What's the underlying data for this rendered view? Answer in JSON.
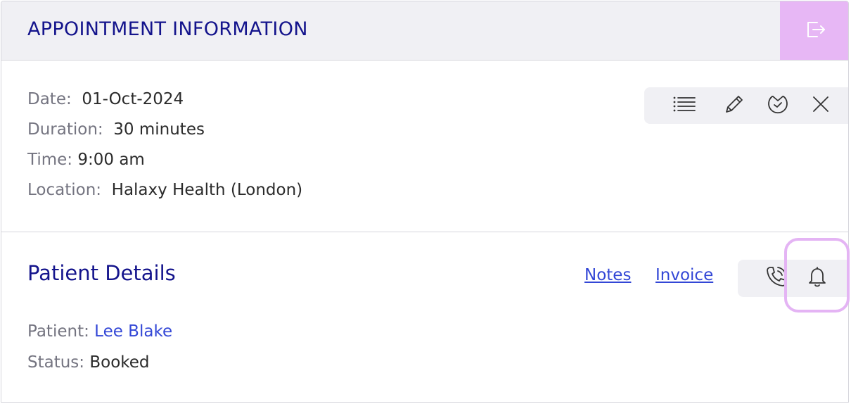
{
  "header": {
    "title": "APPOINTMENT INFORMATION",
    "exit_icon": "exit-icon"
  },
  "appointment": {
    "date_label": "Date:",
    "date_value": "01-Oct-2024",
    "duration_label": "Duration:",
    "duration_value": "30 minutes",
    "time_label": "Time:",
    "time_value": "9:00 am",
    "location_label": "Location:",
    "location_value": "Halaxy Health (London)"
  },
  "toolbar": {
    "icons": [
      "list-icon",
      "pencil-icon",
      "clock-check-icon",
      "close-icon"
    ]
  },
  "patient_section": {
    "title": "Patient Details",
    "notes_link": "Notes",
    "invoice_link": "Invoice",
    "patient_label": "Patient:",
    "patient_value": "Lee Blake",
    "status_label": "Status:",
    "status_value": "Booked",
    "icons": [
      "phone-icon",
      "bell-icon"
    ]
  },
  "colors": {
    "title": "#14148c",
    "link": "#3347d6",
    "accent": "#e7b7f5",
    "header_bg": "#f0f0f4",
    "label": "#747480"
  }
}
